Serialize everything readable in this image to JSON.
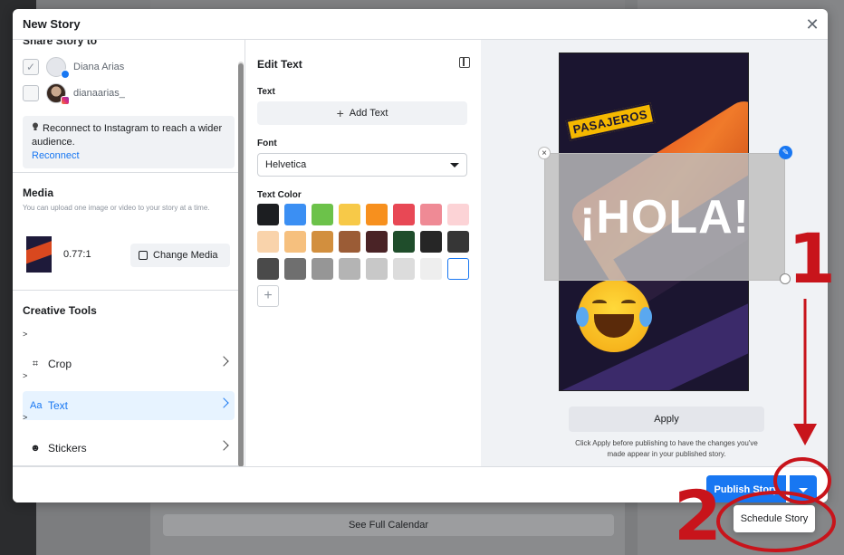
{
  "background": {
    "see_full_calendar": "See Full Calendar"
  },
  "modal": {
    "title": "New Story",
    "close_icon": "close-icon"
  },
  "share": {
    "heading": "Share Story to",
    "accounts": [
      {
        "name": "Diana Arias",
        "network": "facebook",
        "checked": true
      },
      {
        "name": "dianaarias_",
        "network": "instagram",
        "checked": false
      }
    ],
    "reconnect_message": "Reconnect to Instagram to reach a wider audience.",
    "reconnect_link": "Reconnect"
  },
  "media": {
    "title": "Media",
    "hint": "You can upload one image or video to your story at a time.",
    "ratio": "0.77:1",
    "change_button": "Change Media"
  },
  "creative_tools": {
    "title": "Creative Tools",
    "items": [
      {
        "caret": ">",
        "label": "Crop",
        "icon": "crop-icon",
        "active": false
      },
      {
        "caret": ">",
        "label": "Text",
        "icon": "text-icon",
        "active": true
      },
      {
        "caret": ">",
        "label": "Stickers",
        "icon": "sticker-icon",
        "active": false
      }
    ]
  },
  "edit_text": {
    "title": "Edit Text",
    "text_label": "Text",
    "add_text": "Add Text",
    "font_label": "Font",
    "font_value": "Helvetica",
    "color_label": "Text Color",
    "colors": [
      "#1c1e21",
      "#3b8ff3",
      "#6cc24a",
      "#f7c948",
      "#f7901e",
      "#e84855",
      "#ef8a95",
      "#fcd3d6",
      "#f9d3ab",
      "#f6c07e",
      "#d28f3e",
      "#9b5c36",
      "#4a2326",
      "#1f4d2b",
      "#262626",
      "#363636",
      "#4a4a4a",
      "#6f6f6f",
      "#969696",
      "#b4b4b4",
      "#c8c8c8",
      "#dcdcdc",
      "#eeeeee",
      "#ffffff"
    ],
    "selected_color": "#ffffff"
  },
  "preview": {
    "overlay_text": "¡HOLA!",
    "brand_text": "PASAJEROS",
    "apply_button": "Apply",
    "apply_note": "Click Apply before publishing to have the changes you've made appear in your published story."
  },
  "footer": {
    "publish_button": "Publish Story",
    "schedule_option": "Schedule Story"
  },
  "annotations": {
    "step_1": "1",
    "step_2": "2",
    "color": "#c8141b"
  }
}
